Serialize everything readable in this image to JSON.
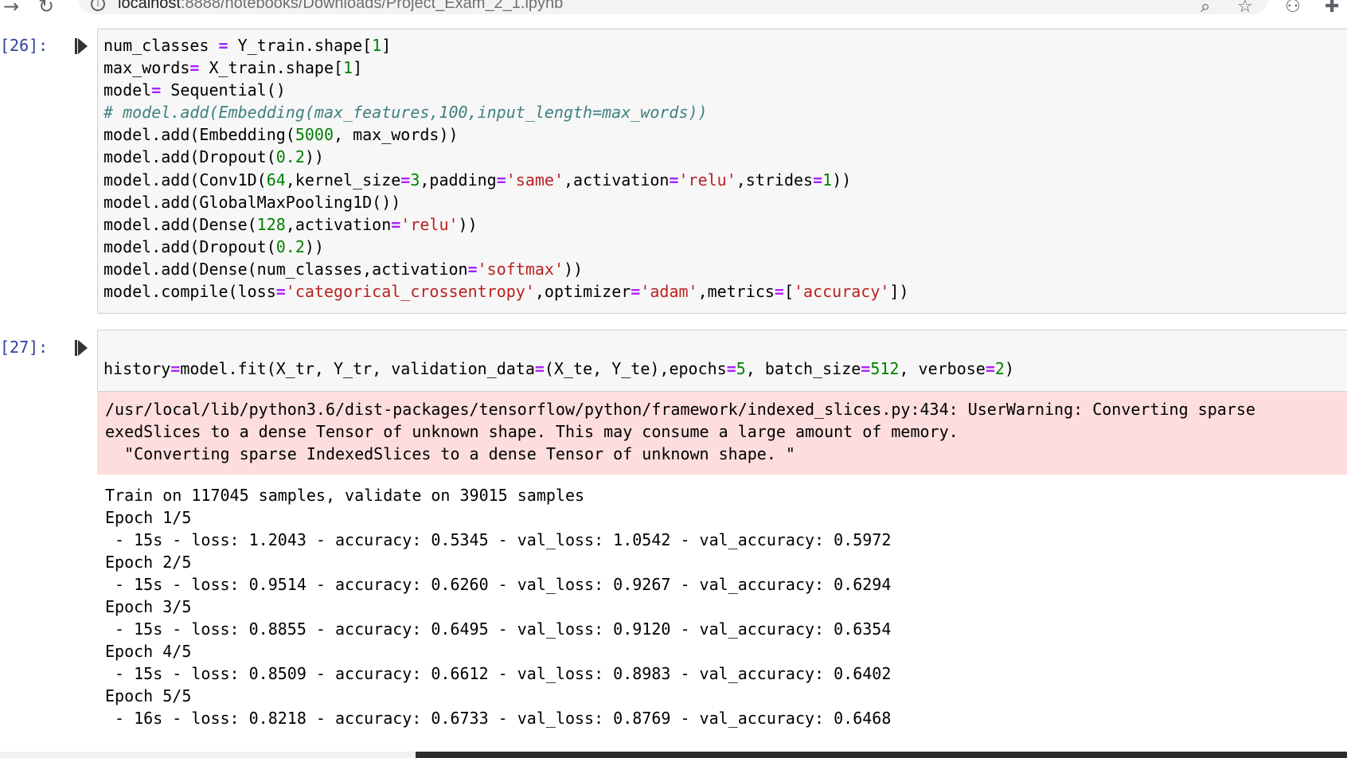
{
  "browser": {
    "url_host": "localhost",
    "url_path": ":8888/notebooks/Downloads/Project_Exam_2_1.ipynb"
  },
  "cells": [
    {
      "prompt": "[26]:",
      "code_lines": [
        [
          [
            "num_classes ",
            ""
          ],
          [
            "=",
            "o"
          ],
          [
            " Y_train.shape[",
            ""
          ],
          [
            "1",
            "n"
          ],
          [
            "]",
            ""
          ]
        ],
        [
          [
            "max_words",
            ""
          ],
          [
            "=",
            "o"
          ],
          [
            " X_train.shape[",
            ""
          ],
          [
            "1",
            "n"
          ],
          [
            "]",
            ""
          ]
        ],
        [
          [
            "model",
            ""
          ],
          [
            "=",
            "o"
          ],
          [
            " Sequential()",
            ""
          ]
        ],
        [
          [
            "# model.add(Embedding(max_features,100,input_length=max_words))",
            "c"
          ]
        ],
        [
          [
            "model.add(Embedding(",
            ""
          ],
          [
            "5000",
            "n"
          ],
          [
            ", max_words))",
            ""
          ]
        ],
        [
          [
            "model.add(Dropout(",
            ""
          ],
          [
            "0.2",
            "n"
          ],
          [
            "))",
            ""
          ]
        ],
        [
          [
            "model.add(Conv1D(",
            ""
          ],
          [
            "64",
            "n"
          ],
          [
            ",kernel_size",
            ""
          ],
          [
            "=",
            "o"
          ],
          [
            "3",
            "n"
          ],
          [
            ",padding",
            ""
          ],
          [
            "=",
            "o"
          ],
          [
            "'same'",
            "s"
          ],
          [
            ",activation",
            ""
          ],
          [
            "=",
            "o"
          ],
          [
            "'relu'",
            "s"
          ],
          [
            ",strides",
            ""
          ],
          [
            "=",
            "o"
          ],
          [
            "1",
            "n"
          ],
          [
            "))",
            ""
          ]
        ],
        [
          [
            "model.add(GlobalMaxPooling1D())",
            ""
          ]
        ],
        [
          [
            "model.add(Dense(",
            ""
          ],
          [
            "128",
            "n"
          ],
          [
            ",activation",
            ""
          ],
          [
            "=",
            "o"
          ],
          [
            "'relu'",
            "s"
          ],
          [
            "))",
            ""
          ]
        ],
        [
          [
            "model.add(Dropout(",
            ""
          ],
          [
            "0.2",
            "n"
          ],
          [
            "))",
            ""
          ]
        ],
        [
          [
            "model.add(Dense(num_classes,activation",
            ""
          ],
          [
            "=",
            "o"
          ],
          [
            "'softmax'",
            "s"
          ],
          [
            "))",
            ""
          ]
        ],
        [
          [
            "model.compile(loss",
            ""
          ],
          [
            "=",
            "o"
          ],
          [
            "'categorical_crossentropy'",
            "s"
          ],
          [
            ",optimizer",
            ""
          ],
          [
            "=",
            "o"
          ],
          [
            "'adam'",
            "s"
          ],
          [
            ",metrics",
            ""
          ],
          [
            "=",
            "o"
          ],
          [
            "[",
            ""
          ],
          [
            "'accuracy'",
            "s"
          ],
          [
            "])",
            ""
          ]
        ]
      ]
    },
    {
      "prompt": "[27]:",
      "code_lines": [
        [
          [
            "",
            ""
          ]
        ],
        [
          [
            "history",
            ""
          ],
          [
            "=",
            "o"
          ],
          [
            "model.fit(X_tr, Y_tr, validation_data",
            ""
          ],
          [
            "=",
            "o"
          ],
          [
            "(X_te, Y_te),epochs",
            ""
          ],
          [
            "=",
            "o"
          ],
          [
            "5",
            "n"
          ],
          [
            ", batch_size",
            ""
          ],
          [
            "=",
            "o"
          ],
          [
            "512",
            "n"
          ],
          [
            ", verbose",
            ""
          ],
          [
            "=",
            "o"
          ],
          [
            "2",
            "n"
          ],
          [
            ")",
            ""
          ]
        ]
      ],
      "stderr": "/usr/local/lib/python3.6/dist-packages/tensorflow/python/framework/indexed_slices.py:434: UserWarning: Converting sparse\nexedSlices to a dense Tensor of unknown shape. This may consume a large amount of memory.\n  \"Converting sparse IndexedSlices to a dense Tensor of unknown shape. \"",
      "stdout": "Train on 117045 samples, validate on 39015 samples\nEpoch 1/5\n - 15s - loss: 1.2043 - accuracy: 0.5345 - val_loss: 1.0542 - val_accuracy: 0.5972\nEpoch 2/5\n - 15s - loss: 0.9514 - accuracy: 0.6260 - val_loss: 0.9267 - val_accuracy: 0.6294\nEpoch 3/5\n - 15s - loss: 0.8855 - accuracy: 0.6495 - val_loss: 0.9120 - val_accuracy: 0.6354\nEpoch 4/5\n - 15s - loss: 0.8509 - accuracy: 0.6612 - val_loss: 0.8983 - val_accuracy: 0.6402\nEpoch 5/5\n - 16s - loss: 0.8218 - accuracy: 0.6733 - val_loss: 0.8769 - val_accuracy: 0.6468"
    }
  ],
  "icons": {
    "forward": "arrow-forward-icon",
    "reload": "reload-icon",
    "info": "site-info-icon",
    "zoom": "zoom-icon",
    "bookmark": "star-icon",
    "extension1": "extension-icon",
    "extension2": "puzzle-icon",
    "run": "run-cell-icon"
  },
  "colors": {
    "prompt": "#303f9f",
    "keyword_op": "#aa22ff",
    "number": "#008000",
    "string": "#ba2121",
    "comment": "#408080",
    "stderr_bg": "#fddddd"
  }
}
